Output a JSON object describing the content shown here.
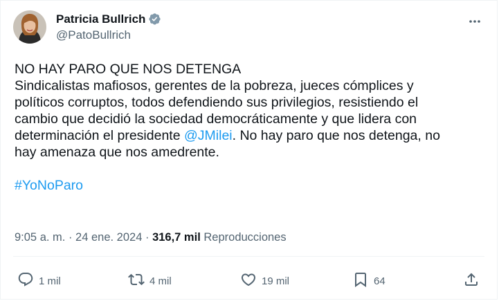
{
  "author": {
    "display_name": "Patricia Bullrich",
    "handle": "@PatoBullrich",
    "verified": true
  },
  "tweet": {
    "line1": "NO HAY PARO QUE NOS DETENGA",
    "line2": "Sindicalistas mafiosos, gerentes de la pobreza, jueces cómplices y",
    "line3": "políticos corruptos, todos defendiendo sus privilegios, resistiendo el",
    "line4": "cambio que decidió la sociedad democráticamente y que lidera con",
    "line5_pre": "determinación el presidente ",
    "mention": "@JMilei",
    "line5_post": ". No hay paro que nos detenga, no",
    "line6": "hay amenaza que nos amedrente.",
    "hashtag": "#YoNoParo"
  },
  "meta": {
    "time": "9:05 a. m.",
    "separator": " · ",
    "date": "24 ene. 2024",
    "views_count": "316,7 mil",
    "views_label": "Reproducciones"
  },
  "actions": {
    "reply_count": "1 mil",
    "retweet_count": "4 mil",
    "like_count": "19 mil",
    "bookmark_count": "64"
  },
  "colors": {
    "accent": "#1d9bf0",
    "text": "#0f1419",
    "secondary": "#536471"
  },
  "icons": {
    "more": "more-icon",
    "verified": "verified-badge-icon",
    "reply": "reply-icon",
    "retweet": "retweet-icon",
    "like": "heart-icon",
    "bookmark": "bookmark-icon",
    "share": "share-icon"
  }
}
